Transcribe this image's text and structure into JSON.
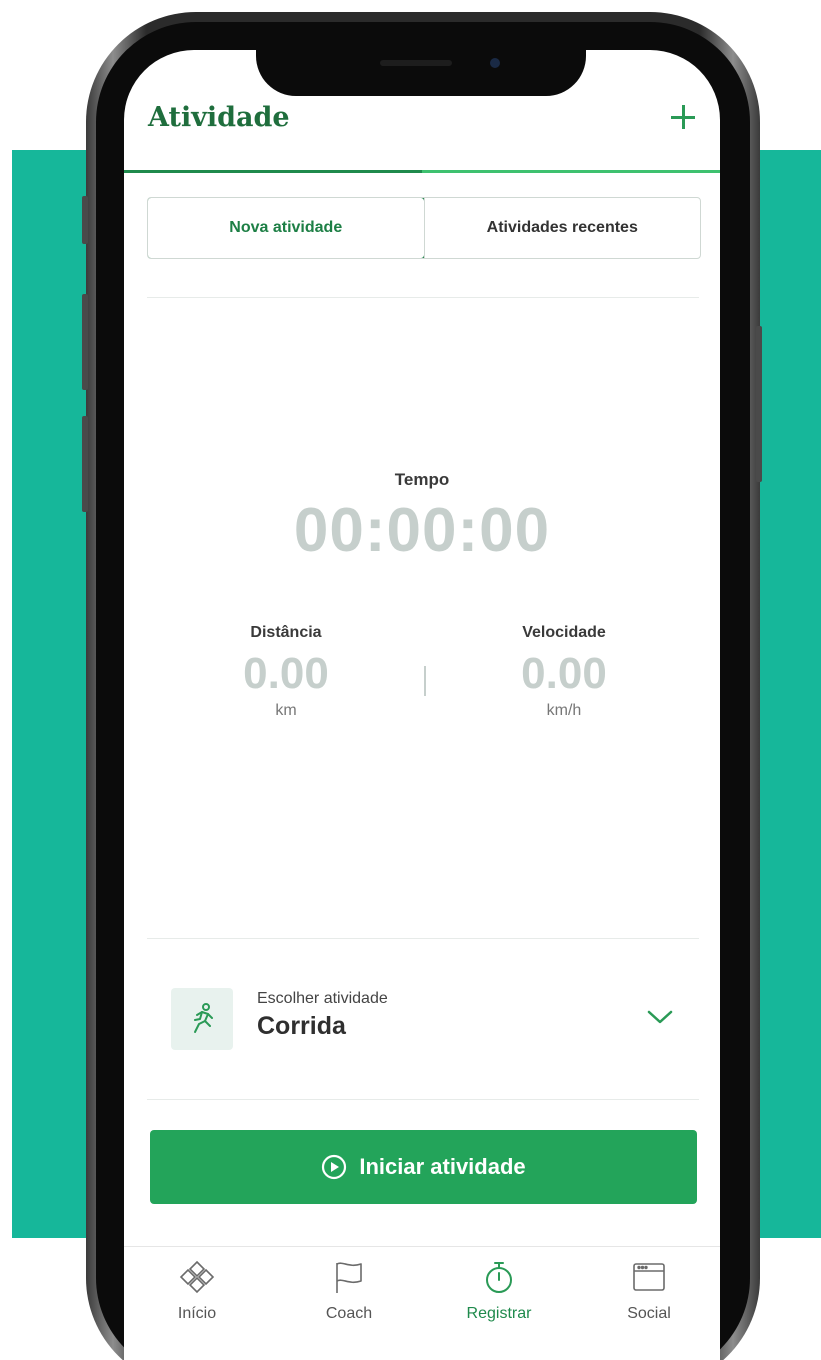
{
  "header": {
    "title": "Atividade",
    "add_icon": "plus-icon"
  },
  "tabs": [
    {
      "label": "Nova atividade",
      "active": true
    },
    {
      "label": "Atividades recentes",
      "active": false
    }
  ],
  "stats": {
    "time": {
      "label": "Tempo",
      "value": "00:00:00"
    },
    "distance": {
      "label": "Distância",
      "value": "0.00",
      "unit": "km"
    },
    "speed": {
      "label": "Velocidade",
      "value": "0.00",
      "unit": "km/h"
    }
  },
  "activity_select": {
    "caption": "Escolher atividade",
    "value": "Corrida",
    "icon": "running-icon",
    "chevron": "chevron-down-icon"
  },
  "start_button": {
    "label": "Iniciar atividade",
    "icon": "play-circle-icon"
  },
  "nav": [
    {
      "label": "Início",
      "icon": "home-icon",
      "active": false
    },
    {
      "label": "Coach",
      "icon": "flag-icon",
      "active": false
    },
    {
      "label": "Registrar",
      "icon": "stopwatch-icon",
      "active": true
    },
    {
      "label": "Social",
      "icon": "browser-icon",
      "active": false
    }
  ],
  "colors": {
    "background_accent": "#16b79a",
    "brand_green": "#1f6e3d",
    "button_green": "#23a45a",
    "muted_value": "#c6cfcc"
  }
}
